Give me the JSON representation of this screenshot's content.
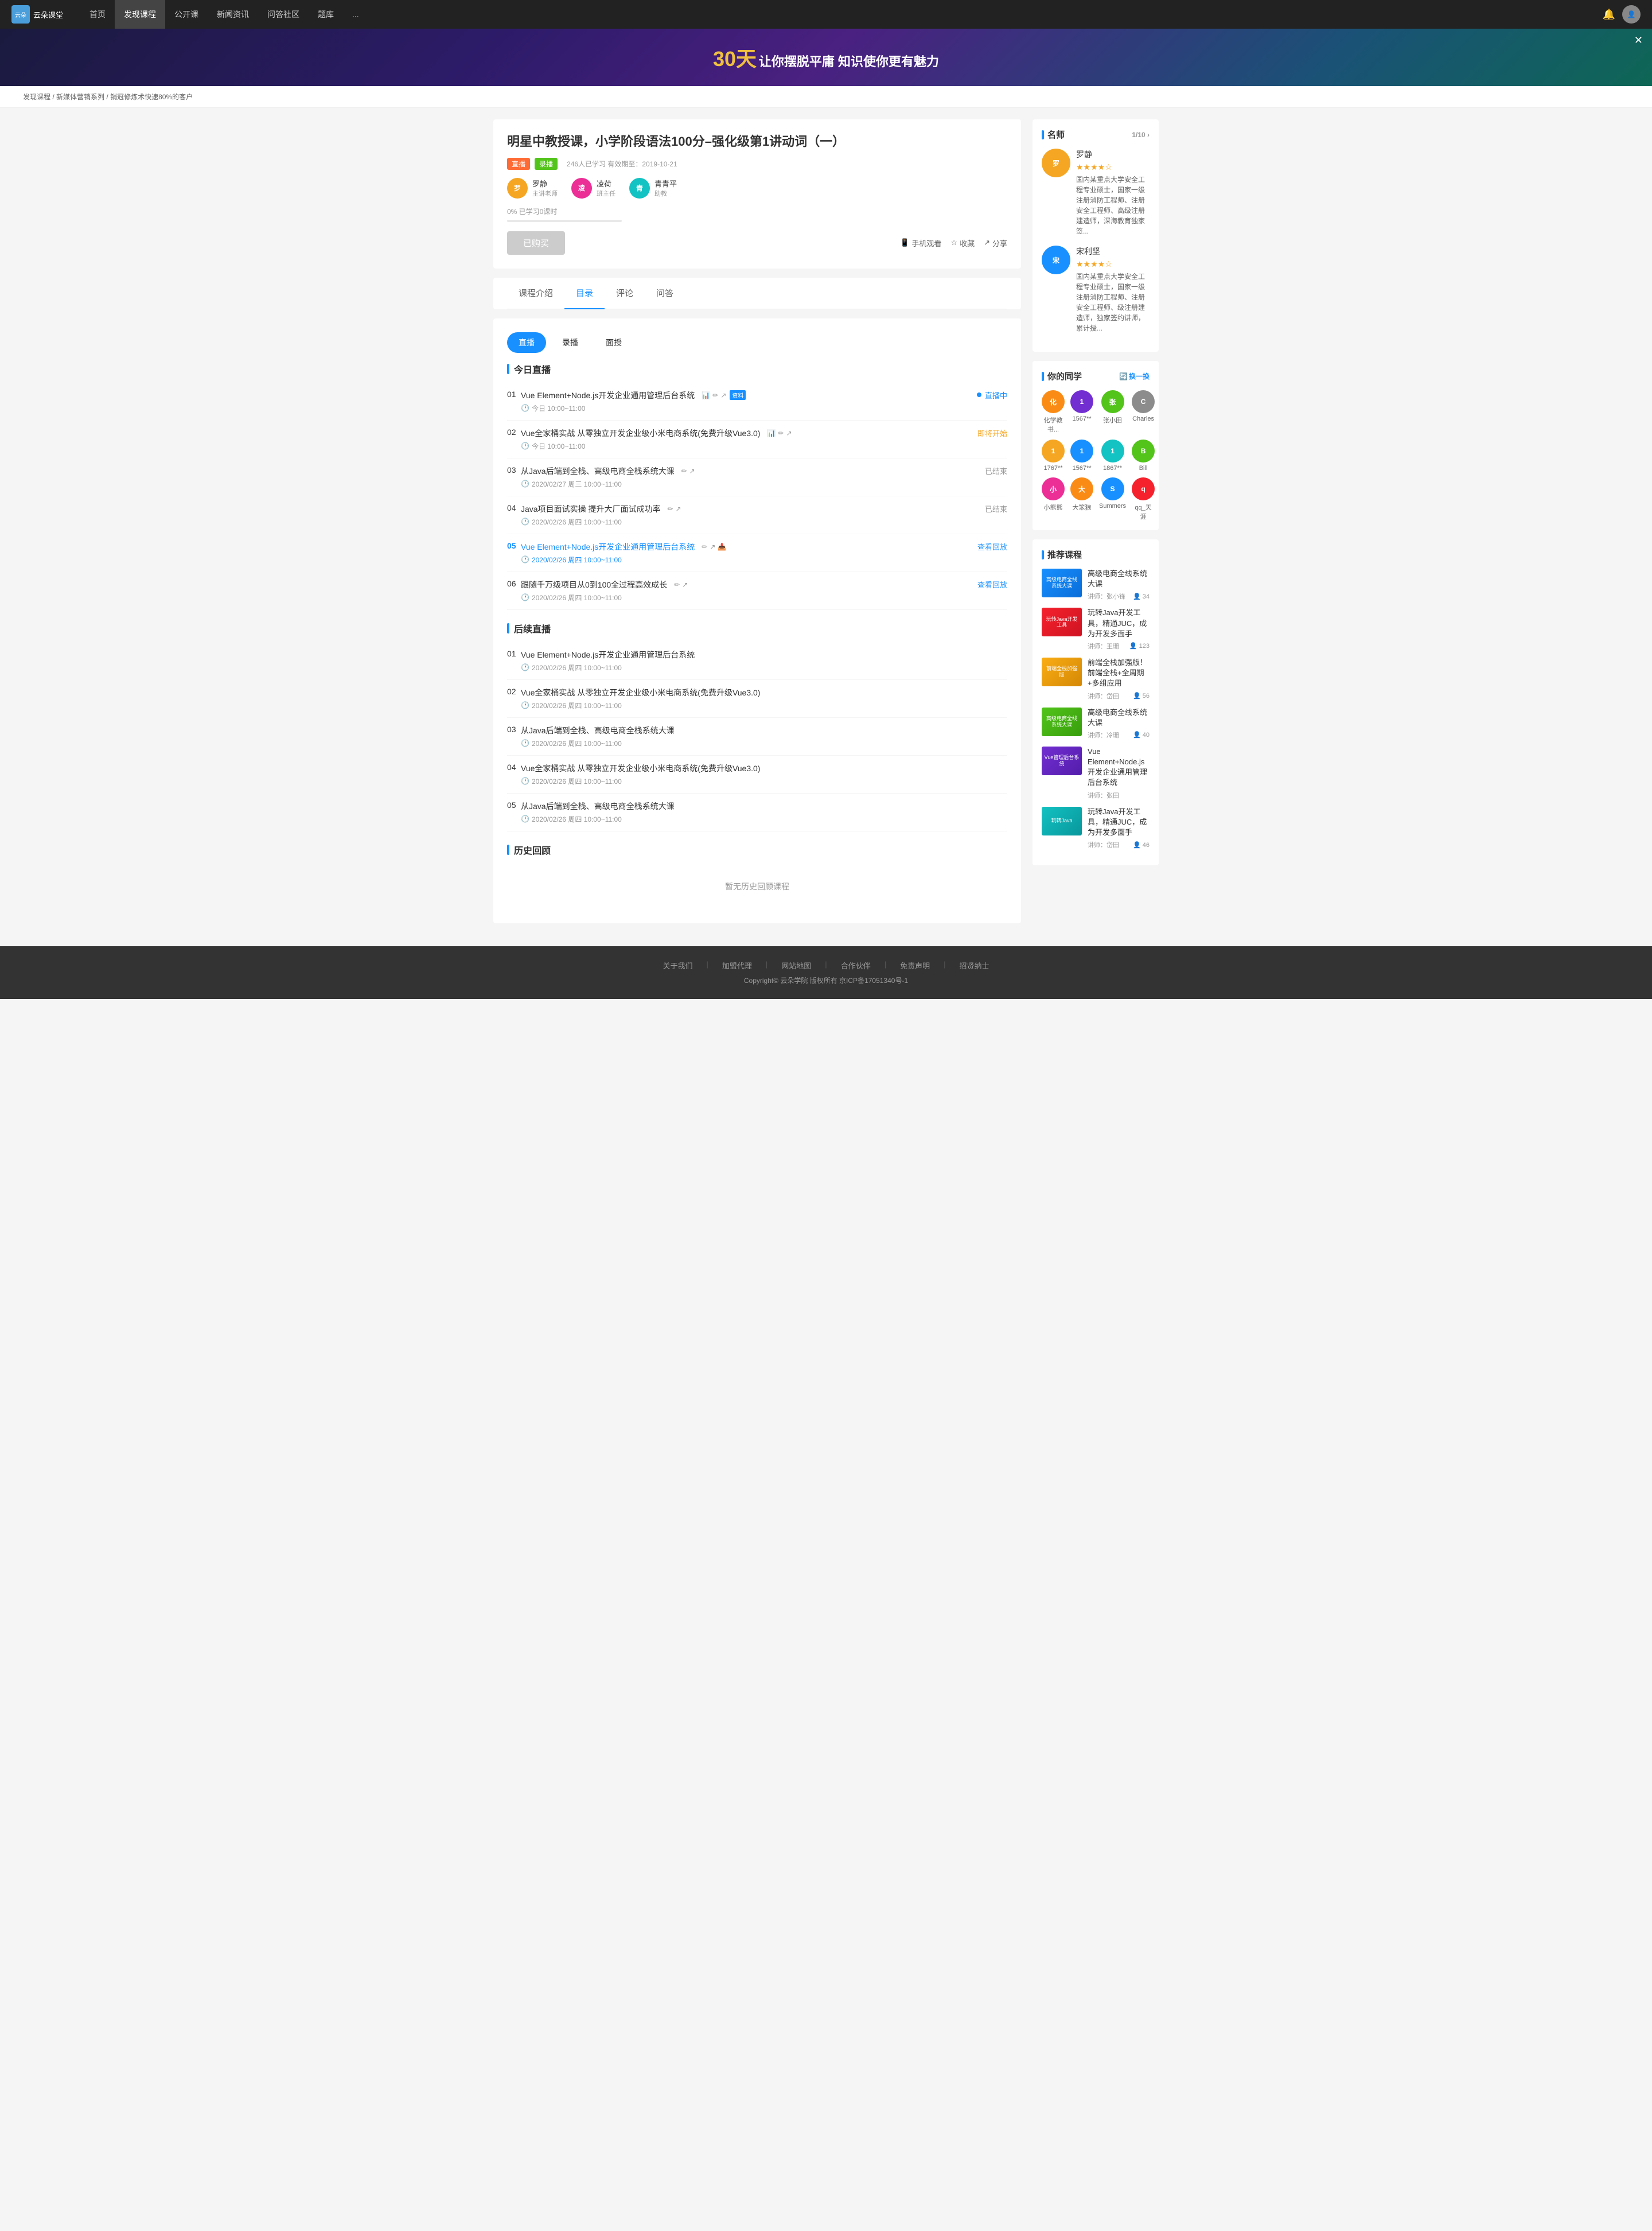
{
  "nav": {
    "logo_text": "云朵课堂",
    "items": [
      {
        "label": "首页",
        "active": false
      },
      {
        "label": "发现课程",
        "active": true
      },
      {
        "label": "公开课",
        "active": false
      },
      {
        "label": "新闻资讯",
        "active": false
      },
      {
        "label": "问答社区",
        "active": false
      },
      {
        "label": "题库",
        "active": false
      },
      {
        "label": "...",
        "active": false
      }
    ]
  },
  "banner": {
    "days": "30天",
    "text": "让你摆脱平庸  知识使你更有魅力"
  },
  "breadcrumb": {
    "items": [
      "发现课程",
      "新媒体营销系列",
      "销冠修炼术快速80%的客户"
    ]
  },
  "course": {
    "title": "明星中教授课，小学阶段语法100分–强化级第1讲动词（一）",
    "tags": [
      "直播",
      "录播"
    ],
    "meta": "246人已学习  有效期至：2019-10-21",
    "instructors": [
      {
        "name": "罗静",
        "role": "主讲老师",
        "initials": "罗"
      },
      {
        "name": "凌荷",
        "role": "班主任",
        "initials": "凌"
      },
      {
        "name": "青青平",
        "role": "助教",
        "initials": "青"
      }
    ],
    "progress_text": "0%  已学习0课时",
    "btn_bought": "已购买",
    "actions": [
      {
        "icon": "📱",
        "label": "手机观看"
      },
      {
        "icon": "☆",
        "label": "收藏"
      },
      {
        "icon": "↗",
        "label": "分享"
      }
    ]
  },
  "tabs": {
    "items": [
      "课程介绍",
      "目录",
      "评论",
      "问答"
    ],
    "active": "目录"
  },
  "content_tabs": {
    "items": [
      "直播",
      "录播",
      "面授"
    ],
    "active": "直播"
  },
  "today_live": {
    "title": "今日直播",
    "items": [
      {
        "num": "01",
        "title": "Vue Element+Node.js开发企业通用管理后台系统",
        "time": "今日 10:00~11:00",
        "status": "直播中",
        "has_material": true
      },
      {
        "num": "02",
        "title": "Vue全家桶实战 从零独立开发企业级小米电商系统(免费升级Vue3.0)",
        "time": "今日 10:00~11:00",
        "status": "即将开始",
        "has_material": false
      },
      {
        "num": "03",
        "title": "从Java后端到全栈、高级电商全栈系统大课",
        "time": "2020/02/27 周三 10:00~11:00",
        "status": "已结束",
        "has_material": false
      },
      {
        "num": "04",
        "title": "Java项目面试实操 提升大厂面试成功率",
        "time": "2020/02/26 周四 10:00~11:00",
        "status": "已结束",
        "has_material": false
      },
      {
        "num": "05",
        "title": "Vue Element+Node.js开发企业通用管理后台系统",
        "time": "2020/02/26 周四 10:00~11:00",
        "status": "查看回放",
        "has_material": false,
        "highlight": true
      },
      {
        "num": "06",
        "title": "跟随千万级项目从0到100全过程高效成长",
        "time": "2020/02/26 周四 10:00~11:00",
        "status": "查看回放",
        "has_material": false
      }
    ]
  },
  "later_live": {
    "title": "后续直播",
    "items": [
      {
        "num": "01",
        "title": "Vue Element+Node.js开发企业通用管理后台系统",
        "time": "2020/02/26 周四 10:00~11:00"
      },
      {
        "num": "02",
        "title": "Vue全家桶实战 从零独立开发企业级小米电商系统(免费升级Vue3.0)",
        "time": "2020/02/26 周四 10:00~11:00"
      },
      {
        "num": "03",
        "title": "从Java后端到全栈、高级电商全栈系统大课",
        "time": "2020/02/26 周四 10:00~11:00"
      },
      {
        "num": "04",
        "title": "Vue全家桶实战 从零独立开发企业级小米电商系统(免费升级Vue3.0)",
        "time": "2020/02/26 周四 10:00~11:00"
      },
      {
        "num": "05",
        "title": "从Java后端到全栈、高级电商全栈系统大课",
        "time": "2020/02/26 周四 10:00~11:00"
      }
    ]
  },
  "history": {
    "title": "历史回顾",
    "empty_text": "暂无历史回顾课程"
  },
  "sidebar": {
    "teachers": {
      "title": "名师",
      "pagination": "1/10 ›",
      "items": [
        {
          "name": "罗静",
          "stars": 4,
          "desc": "国内某重点大学安全工程专业硕士，国家一级注册消防工程师、注册安全工程师、高级注册建造师，深海教育独家签...",
          "initials": "罗",
          "color": "av-yellow"
        },
        {
          "name": "宋利坚",
          "stars": 4,
          "desc": "国内某重点大学安全工程专业硕士，国家一级注册消防工程师、注册安全工程师、级注册建造师，独家签约讲师，累计授...",
          "initials": "宋",
          "color": "av-blue"
        }
      ]
    },
    "classmates": {
      "title": "你的同学",
      "switch_label": "换一换",
      "items": [
        {
          "name": "化学教书...",
          "initials": "化",
          "color": "av-orange"
        },
        {
          "name": "1567**",
          "initials": "1",
          "color": "av-purple"
        },
        {
          "name": "张小田",
          "initials": "张",
          "color": "av-green"
        },
        {
          "name": "Charles",
          "initials": "C",
          "color": "av-gray"
        },
        {
          "name": "1767**",
          "initials": "1",
          "color": "av-yellow"
        },
        {
          "name": "1567**",
          "initials": "1",
          "color": "av-blue"
        },
        {
          "name": "1867**",
          "initials": "1",
          "color": "av-teal"
        },
        {
          "name": "Bill",
          "initials": "B",
          "color": "av-green"
        },
        {
          "name": "小熊熊",
          "initials": "小",
          "color": "av-pink"
        },
        {
          "name": "大笨狼",
          "initials": "大",
          "color": "av-orange"
        },
        {
          "name": "Summers",
          "initials": "S",
          "color": "av-blue"
        },
        {
          "name": "qq_天涯",
          "initials": "q",
          "color": "av-red"
        }
      ]
    },
    "recommended": {
      "title": "推荐课程",
      "items": [
        {
          "title": "高级电商全线系统大课",
          "instructor": "讲师：张小锋",
          "students": "34",
          "thumb_class": "thumb-1",
          "thumb_text": "高级电商全线系统大课"
        },
        {
          "title": "玩转Java开发工具，精通JUC，成为开发多面手",
          "instructor": "讲师：王珊",
          "students": "123",
          "thumb_class": "thumb-2",
          "thumb_text": "玩转Java开发工具"
        },
        {
          "title": "前端全栈加强版！前端全栈+全周期+多组应用",
          "instructor": "讲师：岱田",
          "students": "56",
          "thumb_class": "thumb-3",
          "thumb_text": "前端全栈加强版"
        },
        {
          "title": "高级电商全线系统大课",
          "instructor": "讲师：冷珊",
          "students": "40",
          "thumb_class": "thumb-4",
          "thumb_text": "高级电商全线系统大课"
        },
        {
          "title": "Vue Element+Node.js开发企业通用管理后台系统",
          "instructor": "讲师：张田",
          "students": "",
          "thumb_class": "thumb-5",
          "thumb_text": "Vue管理后台系统"
        },
        {
          "title": "玩转Java开发工具，精通JUC，成为开发多面手",
          "instructor": "讲师：岱田",
          "students": "46",
          "thumb_class": "thumb-6",
          "thumb_text": "玩转Java"
        }
      ]
    }
  },
  "footer": {
    "links": [
      "关于我们",
      "加盟代理",
      "网站地图",
      "合作伙伴",
      "免责声明",
      "招贤纳士"
    ],
    "copyright": "Copyright© 云朵学院  版权所有  京ICP备17051340号-1"
  }
}
